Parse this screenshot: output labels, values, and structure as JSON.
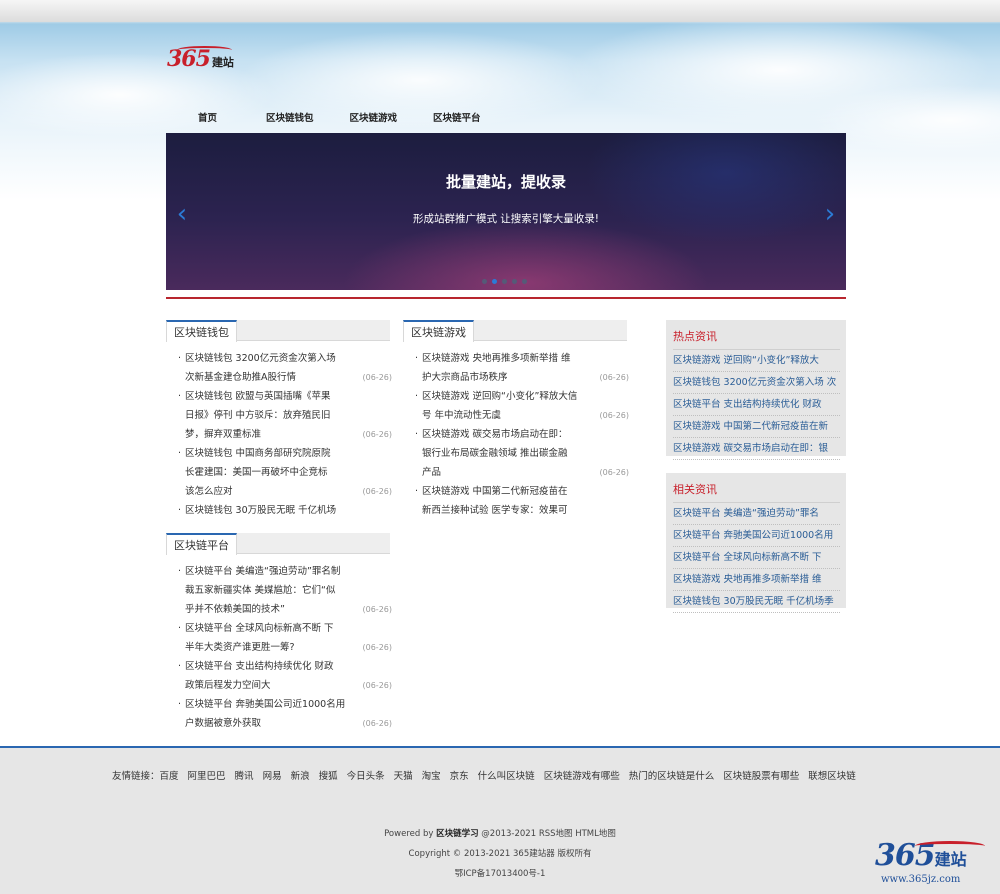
{
  "logo": {
    "number": "365",
    "text": "建站"
  },
  "nav": [
    "首页",
    "区块链钱包",
    "区块链游戏",
    "区块链平台"
  ],
  "banner": {
    "title": "批量建站，提收录",
    "subtitle": "形成站群推广模式 让搜索引擎大量收录!",
    "prev": "‹",
    "next": "›",
    "slide_count": 5,
    "active_slide": 2
  },
  "wallet": {
    "title": "区块链钱包",
    "items": [
      {
        "l1": "区块链钱包 3200亿元资金次第入场",
        "l2": "次新基金建仓助推A股行情",
        "date": "(06-26)"
      },
      {
        "l1": "区块链钱包 欧盟与英国插嘴《苹果",
        "l2": "日报》停刊 中方驳斥：放弃殖民旧",
        "l3": "梦，摒弃双重标准",
        "date": "(06-26)"
      },
      {
        "l1": "区块链钱包 中国商务部研究院原院",
        "l2": "长霍建国：美国一再破坏中企竞标",
        "l3": "该怎么应对",
        "date": "(06-26)"
      },
      {
        "l1": "区块链钱包 30万股民无眠 千亿机场",
        "date": ""
      }
    ]
  },
  "game": {
    "title": "区块链游戏",
    "items": [
      {
        "l1": "区块链游戏 央地再推多项新举措 维",
        "l2": "护大宗商品市场秩序",
        "date": "(06-26)"
      },
      {
        "l1": "区块链游戏 逆回购“小变化”释放大信",
        "l2": "号 年中流动性无虞",
        "date": "(06-26)"
      },
      {
        "l1": "区块链游戏 碳交易市场启动在即：",
        "l2": "银行业布局碳金融领域 推出碳金融",
        "l3": "产品",
        "date": "(06-26)"
      },
      {
        "l1": "区块链游戏 中国第二代新冠疫苗在",
        "l2": "新西兰接种试验 医学专家：效果可",
        "date": ""
      }
    ]
  },
  "platform": {
    "title": "区块链平台",
    "items": [
      {
        "l1": "区块链平台 美编造“强迫劳动”罪名制",
        "l2": "裁五家新疆实体 美媒尴尬：它们“似",
        "l3": "乎并不依赖美国的技术”",
        "date": "(06-26)"
      },
      {
        "l1": "区块链平台 全球风向标新高不断 下",
        "l2": "半年大类资产谁更胜一筹?",
        "date": "(06-26)"
      },
      {
        "l1": "区块链平台 支出结构持续优化 财政",
        "l2": "政策后程发力空间大",
        "date": "(06-26)"
      },
      {
        "l1": "区块链平台 奔驰美国公司近1000名用",
        "l2": "户数据被意外获取",
        "date": "(06-26)"
      }
    ]
  },
  "hot": {
    "title": "热点资讯",
    "items": [
      "区块链游戏 逆回购“小变化”释放大",
      "区块链钱包 3200亿元资金次第入场 次",
      "区块链平台 支出结构持续优化 财政",
      "区块链游戏 中国第二代新冠疫苗在新",
      "区块链游戏 碳交易市场启动在即：银"
    ]
  },
  "related": {
    "title": "相关资讯",
    "items": [
      "区块链平台 美编造“强迫劳动”罪名",
      "区块链平台 奔驰美国公司近1000名用",
      "区块链平台 全球风向标新高不断 下",
      "区块链游戏 央地再推多项新举措 维",
      "区块链钱包 30万股民无眠 千亿机场季"
    ]
  },
  "friends": {
    "label": "友情链接：",
    "links": [
      "百度",
      "阿里巴巴",
      "腾讯",
      "网易",
      "新浪",
      "搜狐",
      "今日头条",
      "天猫",
      "淘宝",
      "京东",
      "什么叫区块链",
      "区块链游戏有哪些",
      "热门的区块链是什么",
      "区块链股票有哪些",
      "联想区块链"
    ]
  },
  "footer": {
    "powered_prefix": "Powered by ",
    "powered_site": "区块链学习",
    "powered_suffix": " @2013-2021 RSS地图 HTML地图",
    "copyright": "Copyright © 2013-2021 365建站器 版权所有",
    "icp": "鄂ICP备17013400号-1"
  },
  "footer_logo": {
    "number": "365",
    "text": "建站",
    "url": "www.365jz.com"
  }
}
